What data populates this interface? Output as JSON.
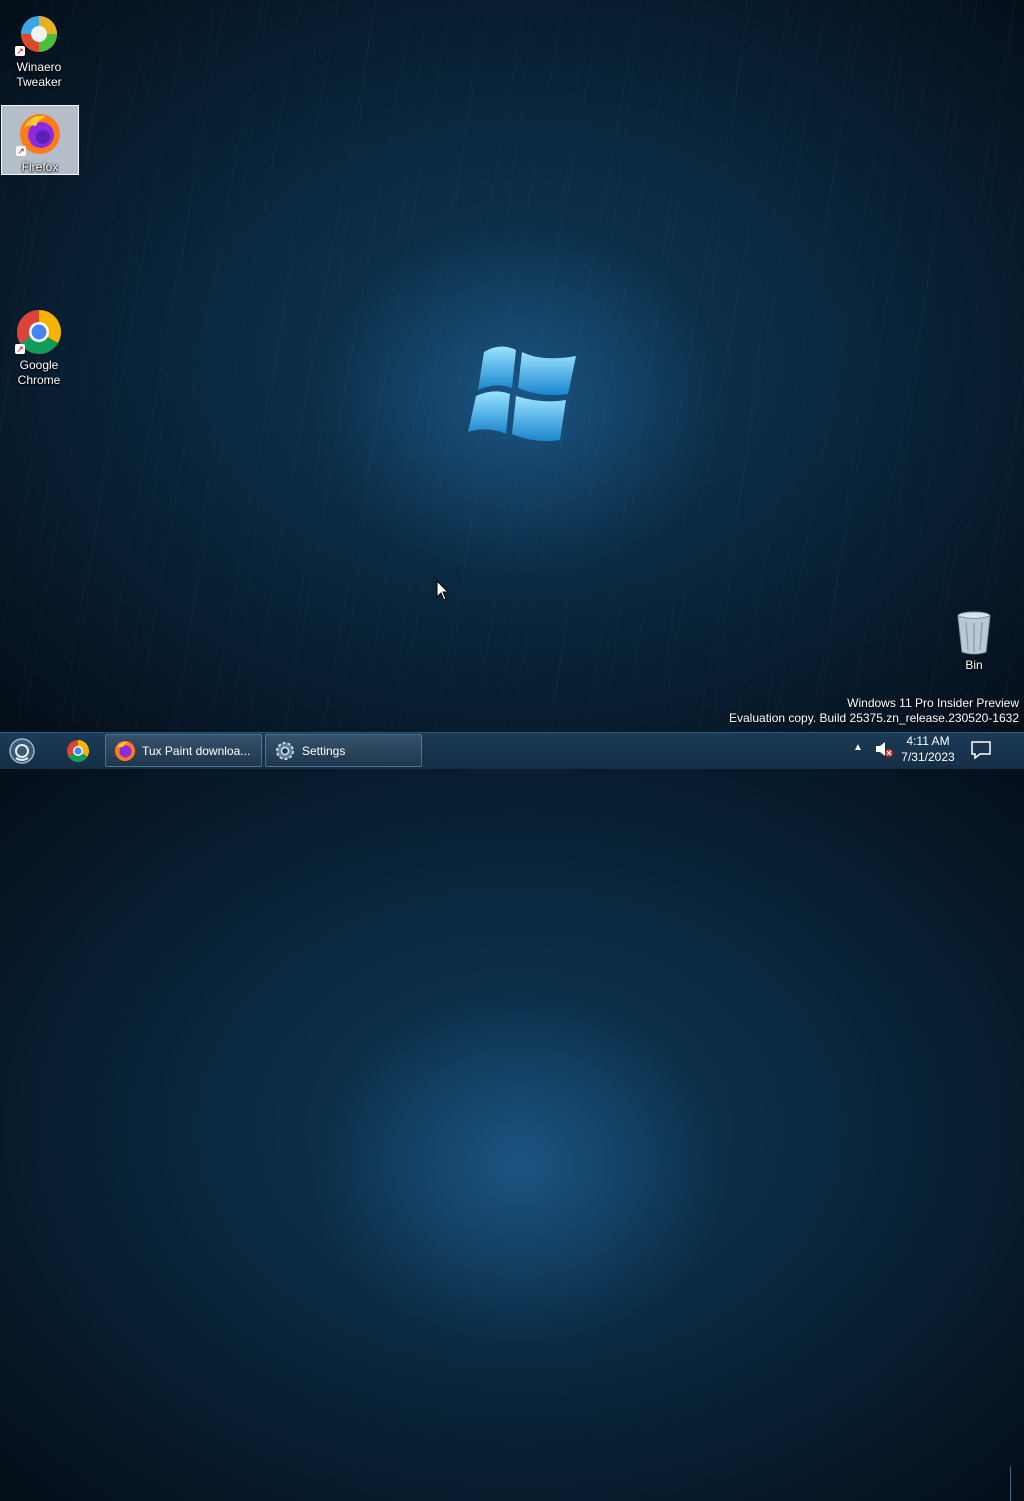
{
  "desktop": {
    "icons": [
      {
        "label_line1": "Winaero",
        "label_line2": "Tweaker"
      },
      {
        "label_line1": "Firefox",
        "label_line2": ""
      },
      {
        "label_line1": "Google",
        "label_line2": "Chrome"
      },
      {
        "label_line1": "Bin",
        "label_line2": ""
      }
    ],
    "watermark": {
      "line1": "Windows 11 Pro Insider Preview",
      "line2": "Evaluation copy. Build 25375.zn_release.230520-1632"
    }
  },
  "taskbar": {
    "tasks": [
      {
        "label": "Tux Paint downloa...",
        "icon": "firefox-icon"
      },
      {
        "label": "Settings",
        "icon": "gear-icon"
      }
    ],
    "clock": {
      "time": "4:11 AM",
      "date": "7/31/2023"
    }
  },
  "colors": {
    "taskbar": "#163249",
    "wallpaper": "#0a2a42",
    "accent": "#2aa0e0"
  }
}
